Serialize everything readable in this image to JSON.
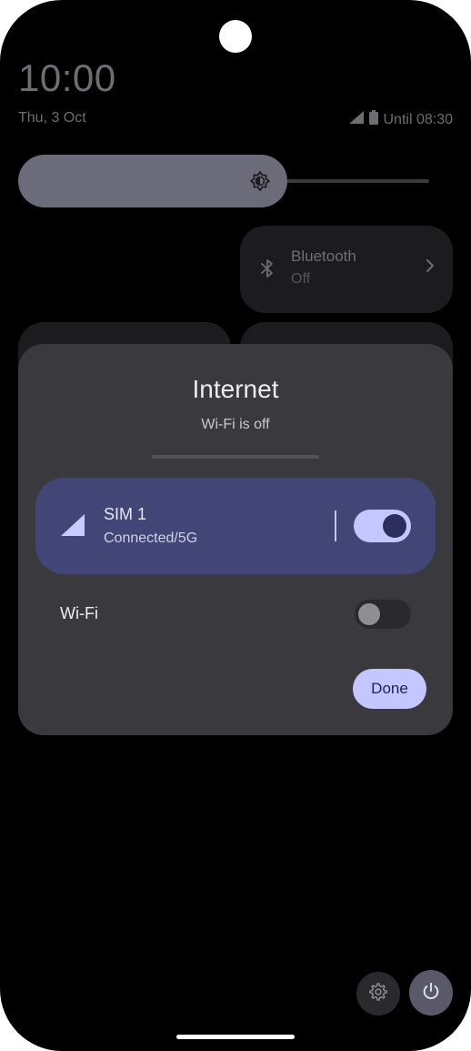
{
  "status": {
    "time": "10:00",
    "date": "Thu, 3 Oct",
    "battery_text": "Until 08:30",
    "icons": [
      "signal-icon",
      "battery-icon"
    ]
  },
  "brightness": {
    "level": 0.55,
    "icon": "brightness-icon"
  },
  "tiles": {
    "bluetooth": {
      "title": "Bluetooth",
      "state": "Off",
      "icon": "bluetooth-icon"
    }
  },
  "dialog": {
    "title": "Internet",
    "subtitle": "Wi-Fi is off",
    "sim": {
      "title": "SIM 1",
      "status": "Connected/5G",
      "enabled": true
    },
    "wifi": {
      "label": "Wi-Fi",
      "enabled": false
    },
    "done_label": "Done"
  },
  "footer": {
    "settings_icon": "gear-icon",
    "power_icon": "power-icon"
  },
  "colors": {
    "accent": "#c4c6ff",
    "sim_card": "#424677",
    "dialog_bg": "#3a3a3e",
    "brightness_fill": "#6c6b7a"
  }
}
